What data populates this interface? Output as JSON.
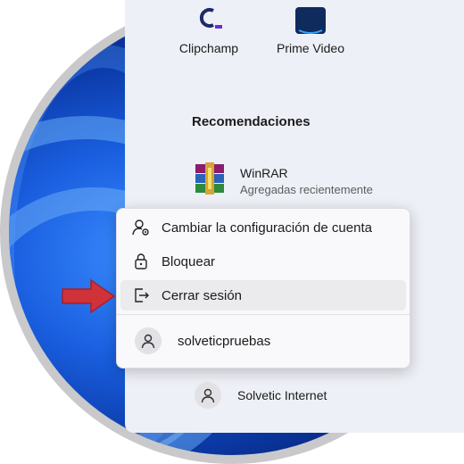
{
  "pinned": [
    {
      "label": "Clipchamp",
      "icon": "clipchamp-icon"
    },
    {
      "label": "Prime Video",
      "icon": "prime-video-icon"
    }
  ],
  "recommendations": {
    "title": "Recomendaciones",
    "items": [
      {
        "name": "WinRAR",
        "subtitle": "Agregadas recientemente",
        "icon": "winrar-icon"
      }
    ]
  },
  "account_menu": {
    "items": [
      {
        "label": "Cambiar la configuración de cuenta",
        "icon": "account-settings-icon"
      },
      {
        "label": "Bloquear",
        "icon": "lock-icon"
      },
      {
        "label": "Cerrar sesión",
        "icon": "sign-out-icon",
        "highlighted": true
      }
    ],
    "other_user": {
      "name": "solveticpruebas",
      "icon": "user-icon"
    }
  },
  "current_user": {
    "name": "Solvetic Internet",
    "icon": "user-icon"
  },
  "colors": {
    "annotation_arrow": "#d0323a",
    "menu_bg": "#f9f9fb",
    "panel_bg": "#eef0f7"
  }
}
